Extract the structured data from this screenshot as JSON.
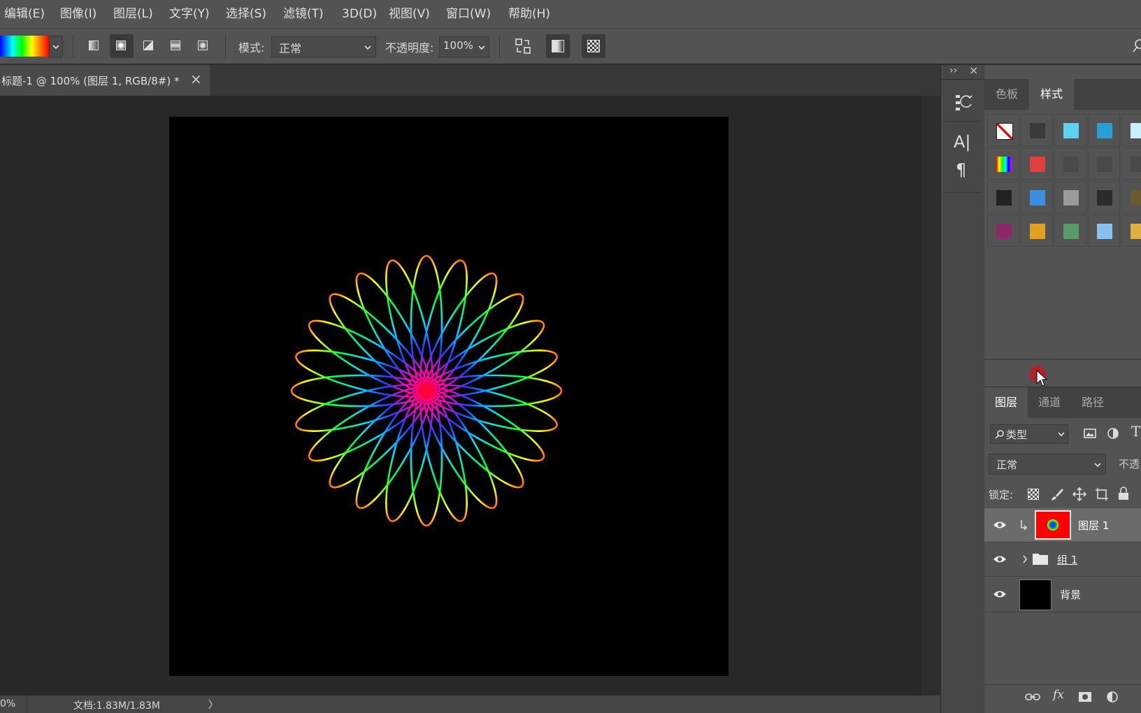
{
  "menu": [
    "编辑(E)",
    "图像(I)",
    "图层(L)",
    "文字(Y)",
    "选择(S)",
    "滤镜(T)",
    "3D(D)",
    "视图(V)",
    "窗口(W)",
    "帮助(H)"
  ],
  "options": {
    "mode_label": "模式:",
    "mode_value": "正常",
    "opacity_label": "不透明度:",
    "opacity_value": "100%"
  },
  "document_tab": {
    "title": "标题-1 @ 100% (图层 1, RGB/8#) *",
    "close": "×"
  },
  "status": {
    "zoom": "0%",
    "doc": "文档:1.83M/1.83M",
    "arrow": "〉"
  },
  "dock": {
    "collapse": "››",
    "close": "×",
    "type_tool": "A|",
    "paragraph": "¶"
  },
  "styles_panel": {
    "tabs": [
      "色板",
      "样式"
    ],
    "active_tab": "样式",
    "swatch_colors": [
      [
        "none",
        "#3a3a3a",
        "#5fd0f0",
        "#2a9fd6",
        "#c8f0ff"
      ],
      [
        "rainbow",
        "#e04040",
        "#4a4a4a",
        "#4a4a4a",
        "#4a4a4a"
      ],
      [
        "#222222",
        "#3a8fe0",
        "#9a9a9a",
        "#2b2b2b",
        "#6a5a30"
      ],
      [
        "#8a2a6a",
        "#e0a020",
        "#5a9a6a",
        "#8ac0f0",
        "#e0b040"
      ]
    ]
  },
  "layers_panel": {
    "tabs": [
      "图层",
      "通道",
      "路径"
    ],
    "active_tab": "图层",
    "filter_kind": "类型",
    "blend_mode": "正常",
    "opacity_label": "不透",
    "lock_label": "锁定:",
    "layers": [
      {
        "name": "图层 1",
        "selected": true,
        "thumb": "#ff0000"
      },
      {
        "name": "组 1",
        "selected": false,
        "thumb": "folder"
      },
      {
        "name": "背景",
        "selected": false,
        "thumb": "#000000"
      }
    ],
    "footer_icons": [
      "link-icon",
      "fx-icon",
      "mask-icon",
      "adjustment-icon"
    ],
    "fx_text": "fx"
  },
  "artwork": {
    "petals": 24,
    "colors": [
      "#ff0040",
      "#ff00c0",
      "#2040ff",
      "#00e0ff",
      "#00ff40",
      "#ffff00",
      "#ff2020"
    ]
  }
}
